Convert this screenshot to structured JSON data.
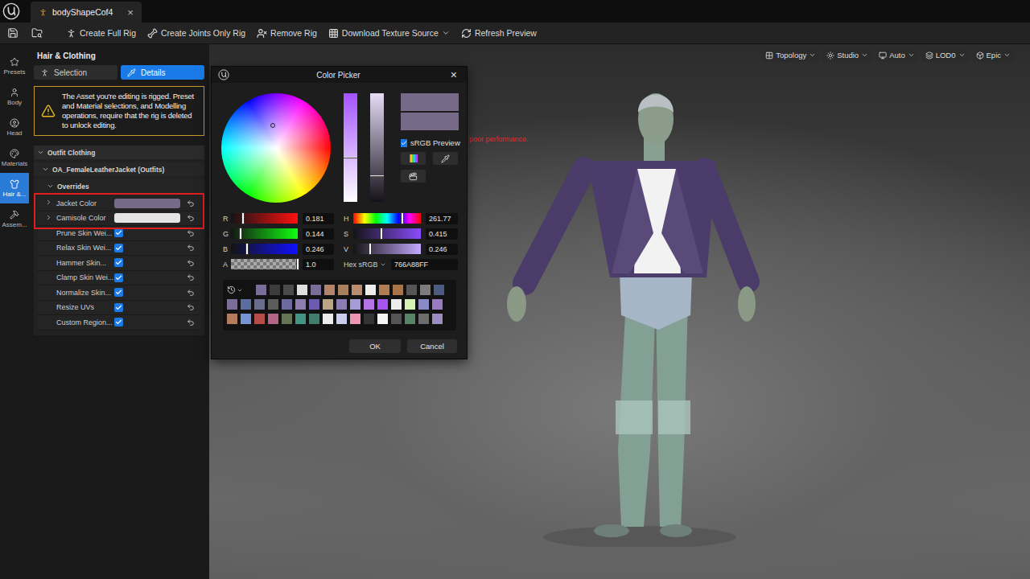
{
  "app_tabs": [
    {
      "label": "bodyShapeCof4",
      "selected": true,
      "close": "×"
    }
  ],
  "toolbar": {
    "buttons": [
      {
        "label": "Create Full Rig",
        "dropdown": false
      },
      {
        "label": "Create Joints Only Rig",
        "dropdown": false
      },
      {
        "label": "Remove Rig",
        "dropdown": false
      },
      {
        "label": "Download Texture Source",
        "dropdown": true
      },
      {
        "label": "Refresh Preview",
        "dropdown": false
      }
    ]
  },
  "nav": [
    {
      "label": "Presets",
      "selected": false
    },
    {
      "label": "Body",
      "selected": false
    },
    {
      "label": "Head",
      "selected": false
    },
    {
      "label": "Materials",
      "selected": false
    },
    {
      "label": "Hair &...",
      "selected": true
    },
    {
      "label": "Assem...",
      "selected": false
    }
  ],
  "panel": {
    "title": "Hair & Clothing",
    "tabs": [
      {
        "label": "Selection",
        "selected": false
      },
      {
        "label": "Details",
        "selected": true
      }
    ],
    "warning": "The Asset you're editing is rigged. Preset and Material selections, and Modelling operations, require that the rig is deleted to unlock editing.",
    "section": "Outfit Clothing",
    "asset": "OA_FemaleLeatherJacket (Outfits)",
    "group": "Overrides",
    "properties": [
      {
        "label": "Jacket Color",
        "kind": "color",
        "color": "#766A88",
        "highlighted": true
      },
      {
        "label": "Camisole Color",
        "kind": "color",
        "color": "#E4E4E4",
        "highlighted": true
      },
      {
        "label": "Prune Skin Wei...",
        "kind": "checkbox",
        "checked": true,
        "highlighted": false
      },
      {
        "label": "Relax Skin Wei...",
        "kind": "checkbox",
        "checked": true,
        "highlighted": false
      },
      {
        "label": "Hammer Skin...",
        "kind": "checkbox",
        "checked": true,
        "highlighted": false
      },
      {
        "label": "Clamp Skin Wei...",
        "kind": "checkbox",
        "checked": true,
        "highlighted": false
      },
      {
        "label": "Normalize Skin...",
        "kind": "checkbox",
        "checked": true,
        "highlighted": false
      },
      {
        "label": "Resize UVs",
        "kind": "checkbox",
        "checked": true,
        "highlighted": false
      },
      {
        "label": "Custom Region...",
        "kind": "checkbox",
        "checked": true,
        "highlighted": false
      }
    ]
  },
  "viewport": {
    "buttons": [
      "Topology",
      "Studio",
      "Auto",
      "LOD0",
      "Epic"
    ],
    "warning": "poor performance."
  },
  "color_picker": {
    "title": "Color Picker",
    "close": "×",
    "wheel": {
      "hue_level": 0.7271,
      "saturation_level": 0.415
    },
    "bars": [
      {
        "name": "saturation",
        "level": 0.415
      },
      {
        "name": "value",
        "level": 0.246
      }
    ],
    "new_color": "#766A88",
    "old_color": "#766A88",
    "srgb_preview": {
      "label": "sRGB Preview",
      "checked": true
    },
    "rgba_channels": [
      {
        "label": "R",
        "value": "0.181",
        "level": 0.181,
        "kind": "color",
        "color": "#ff1010"
      },
      {
        "label": "G",
        "value": "0.144",
        "level": 0.144,
        "kind": "color",
        "color": "#10ff10"
      },
      {
        "label": "B",
        "value": "0.246",
        "level": 0.246,
        "kind": "color",
        "color": "#1010ff"
      },
      {
        "label": "A",
        "value": "1.0",
        "level": 1.0,
        "kind": "alpha",
        "color": "#766A88"
      }
    ],
    "hsv_channels": [
      {
        "label": "H",
        "value": "261.77",
        "level": 0.7271,
        "kind": "hue",
        "color": "#ff0000"
      },
      {
        "label": "S",
        "value": "0.415",
        "level": 0.415,
        "kind": "color",
        "color": "#8a4cff"
      },
      {
        "label": "V",
        "value": "0.246",
        "level": 0.246,
        "kind": "color",
        "color": "#c4a8ff"
      }
    ],
    "hex": {
      "label": "Hex sRGB",
      "value": "766A88FF"
    },
    "swatch_rows": [
      [
        {
          "color": "#7a6e99"
        },
        {
          "color": "#3c3c3c"
        },
        {
          "color": "#4a4a4a"
        },
        {
          "color": "#dedede"
        },
        {
          "color": "#7a6e99"
        },
        {
          "color": "#b4846a"
        },
        {
          "color": "#a8805e"
        },
        {
          "color": "#b88c6c"
        },
        {
          "color": "#ececec"
        },
        {
          "color": "#b27c54"
        },
        {
          "color": "#a87448"
        },
        {
          "color": "#555555"
        },
        {
          "color": "#7c7c7c"
        },
        {
          "color": "#4c5c80"
        }
      ],
      [
        {
          "color": "#7a6e99"
        },
        {
          "color": "#5a6ca0"
        },
        {
          "color": "#6a6c8c"
        },
        {
          "color": "#5c5c5c"
        },
        {
          "color": "#6c6aa0"
        },
        {
          "color": "#8c7cb0"
        },
        {
          "color": "#6c5cb0"
        },
        {
          "color": "#bca484"
        },
        {
          "color": "#8c7cb4"
        },
        {
          "color": "#a49cd6"
        },
        {
          "color": "#b474e6"
        },
        {
          "color": "#a854f4"
        },
        {
          "color": "#ececec"
        },
        {
          "color": "#d4f4b4"
        },
        {
          "color": "#8a8ac8"
        },
        {
          "color": "#9a7ac0"
        }
      ],
      [
        {
          "color": "#b47c5c"
        },
        {
          "color": "#7494d4"
        },
        {
          "color": "#b44c4c"
        },
        {
          "color": "#b46484"
        },
        {
          "color": "#647454"
        },
        {
          "color": "#449484"
        },
        {
          "color": "#447c6c"
        },
        {
          "color": "#ececec"
        },
        {
          "color": "#ccccec"
        },
        {
          "color": "#ec94b4"
        },
        {
          "color": "#343434"
        },
        {
          "color": "#f4f4f4"
        },
        {
          "color": "#545454"
        },
        {
          "color": "#548464"
        },
        {
          "color": "#6c6c6c"
        },
        {
          "color": "#9c8cc0"
        }
      ]
    ],
    "buttons": [
      "OK",
      "Cancel"
    ]
  }
}
